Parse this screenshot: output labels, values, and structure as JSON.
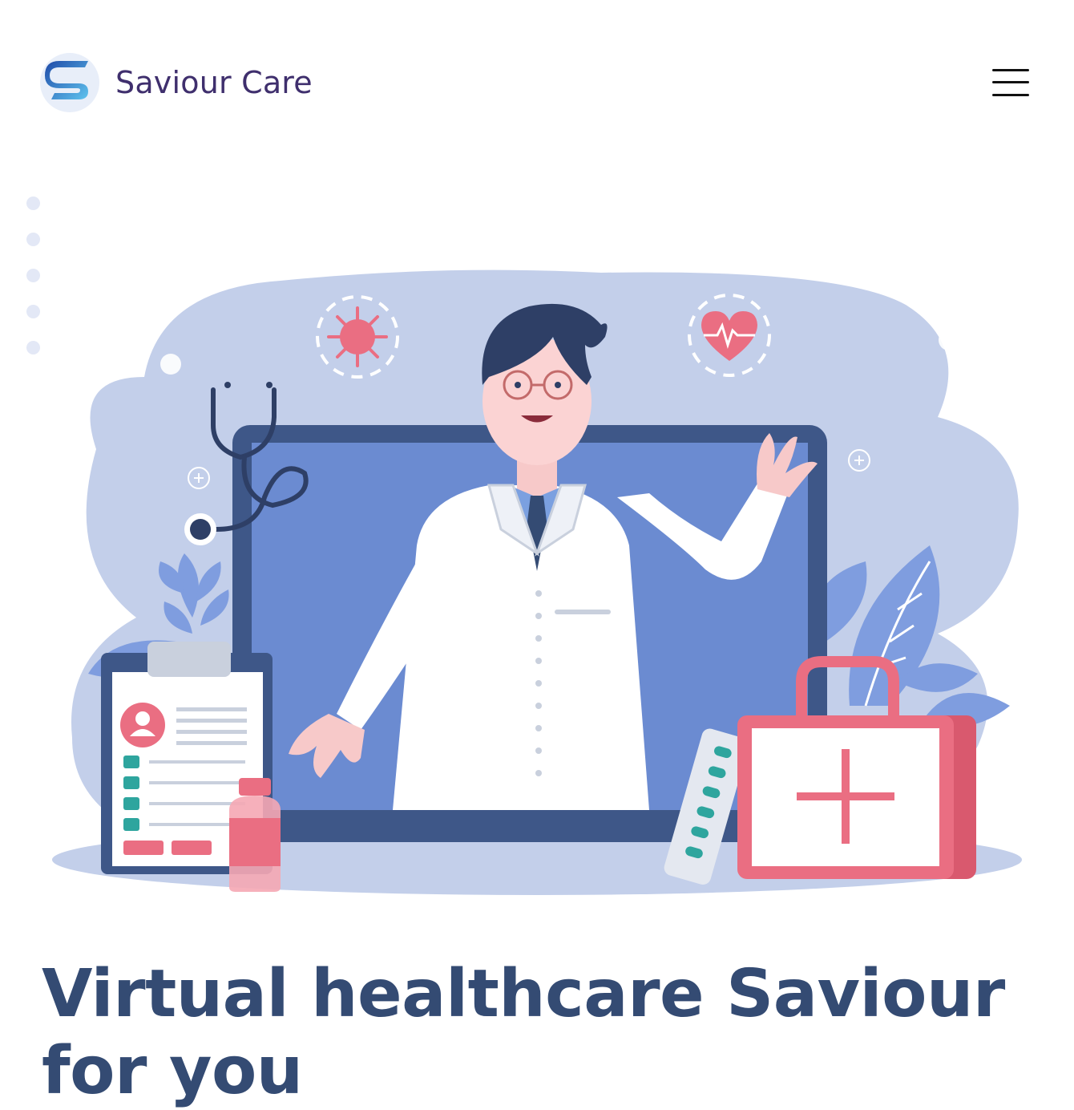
{
  "header": {
    "brand_name": "Saviour Care",
    "logo_icon": "s-logo-icon",
    "menu_icon": "hamburger-menu-icon"
  },
  "hero": {
    "illustration": "doctor-video-consultation-illustration",
    "headline": "Virtual healthcare Saviour for you"
  },
  "colors": {
    "brand_text": "#3f2f6d",
    "headline": "#344b73",
    "blob": "#c3cfea",
    "screen": "#6b8bd1",
    "frame": "#3e5788",
    "accent_red": "#ea6e82",
    "logo_blue": "#2f7fd8"
  }
}
